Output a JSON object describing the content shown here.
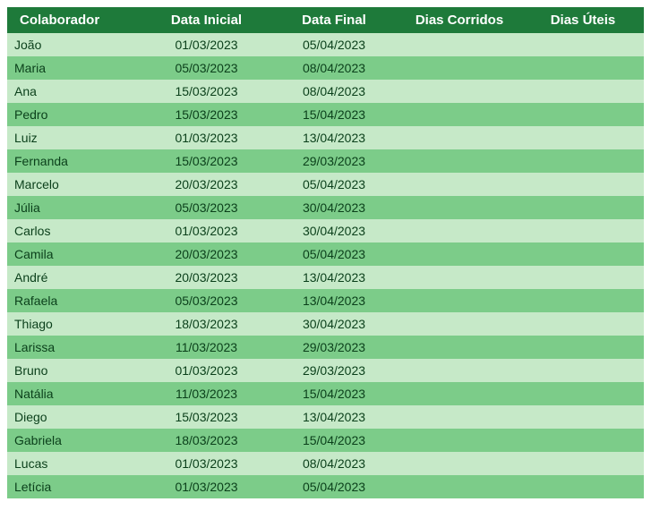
{
  "table": {
    "headers": [
      "Colaborador",
      "Data Inicial",
      "Data Final",
      "Dias Corridos",
      "Dias Úteis"
    ],
    "rows": [
      {
        "name": "João",
        "start": "01/03/2023",
        "end": "05/04/2023",
        "corridos": "",
        "uteis": ""
      },
      {
        "name": "Maria",
        "start": "05/03/2023",
        "end": "08/04/2023",
        "corridos": "",
        "uteis": ""
      },
      {
        "name": "Ana",
        "start": "15/03/2023",
        "end": "08/04/2023",
        "corridos": "",
        "uteis": ""
      },
      {
        "name": "Pedro",
        "start": "15/03/2023",
        "end": "15/04/2023",
        "corridos": "",
        "uteis": ""
      },
      {
        "name": "Luiz",
        "start": "01/03/2023",
        "end": "13/04/2023",
        "corridos": "",
        "uteis": ""
      },
      {
        "name": "Fernanda",
        "start": "15/03/2023",
        "end": "29/03/2023",
        "corridos": "",
        "uteis": ""
      },
      {
        "name": "Marcelo",
        "start": "20/03/2023",
        "end": "05/04/2023",
        "corridos": "",
        "uteis": ""
      },
      {
        "name": "Júlia",
        "start": "05/03/2023",
        "end": "30/04/2023",
        "corridos": "",
        "uteis": ""
      },
      {
        "name": "Carlos",
        "start": "01/03/2023",
        "end": "30/04/2023",
        "corridos": "",
        "uteis": ""
      },
      {
        "name": "Camila",
        "start": "20/03/2023",
        "end": "05/04/2023",
        "corridos": "",
        "uteis": ""
      },
      {
        "name": "André",
        "start": "20/03/2023",
        "end": "13/04/2023",
        "corridos": "",
        "uteis": ""
      },
      {
        "name": "Rafaela",
        "start": "05/03/2023",
        "end": "13/04/2023",
        "corridos": "",
        "uteis": ""
      },
      {
        "name": "Thiago",
        "start": "18/03/2023",
        "end": "30/04/2023",
        "corridos": "",
        "uteis": ""
      },
      {
        "name": "Larissa",
        "start": "11/03/2023",
        "end": "29/03/2023",
        "corridos": "",
        "uteis": ""
      },
      {
        "name": "Bruno",
        "start": "01/03/2023",
        "end": "29/03/2023",
        "corridos": "",
        "uteis": ""
      },
      {
        "name": "Natália",
        "start": "11/03/2023",
        "end": "15/04/2023",
        "corridos": "",
        "uteis": ""
      },
      {
        "name": "Diego",
        "start": "15/03/2023",
        "end": "13/04/2023",
        "corridos": "",
        "uteis": ""
      },
      {
        "name": "Gabriela",
        "start": "18/03/2023",
        "end": "15/04/2023",
        "corridos": "",
        "uteis": ""
      },
      {
        "name": "Lucas",
        "start": "01/03/2023",
        "end": "08/04/2023",
        "corridos": "",
        "uteis": ""
      },
      {
        "name": "Letícia",
        "start": "01/03/2023",
        "end": "05/04/2023",
        "corridos": "",
        "uteis": ""
      }
    ]
  }
}
